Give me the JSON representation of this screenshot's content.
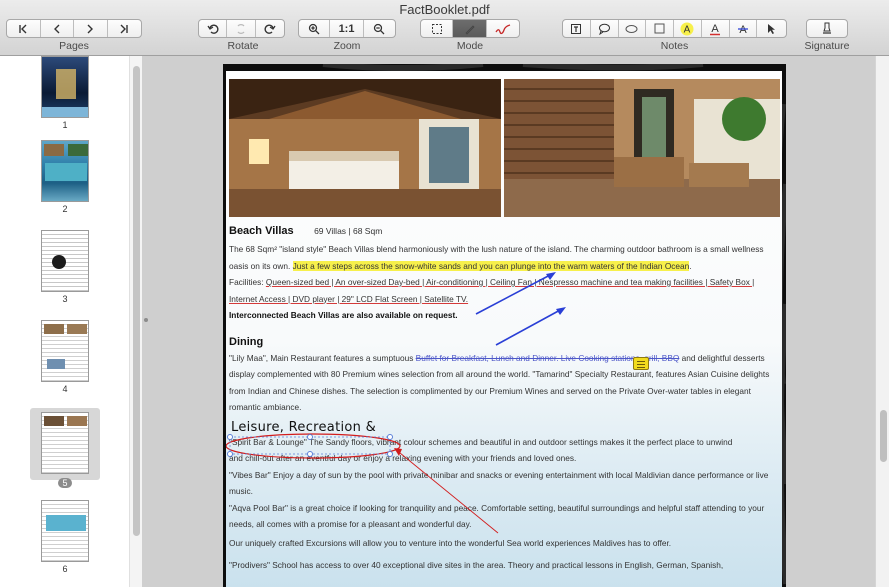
{
  "window": {
    "title": "FactBooklet.pdf"
  },
  "toolbar": {
    "pages_label": "Pages",
    "rotate_label": "Rotate",
    "zoom_label": "Zoom",
    "zoom_actual": "1:1",
    "mode_label": "Mode",
    "notes_label": "Notes",
    "signature_label": "Signature"
  },
  "sidebar": {
    "pages": [
      {
        "num": "1"
      },
      {
        "num": "2"
      },
      {
        "num": "3"
      },
      {
        "num": "4"
      },
      {
        "num": "5",
        "selected": true
      },
      {
        "num": "6"
      }
    ]
  },
  "document": {
    "beach_heading": "Beach Villas",
    "beach_meta": "69 Villas | 68 Sqm",
    "beach_p1a": "The 68 Sqm² \"island style\" Beach Villas blend harmoniously with the lush nature of the island. The charming outdoor bathroom is a    small wellness",
    "beach_p1b": "oasis on its own. ",
    "beach_highlight": "Just a few steps across the snow-white sands and you can plunge into the warm waters of the Indian Ocean",
    "beach_p1c": ".",
    "facilities_label": "Facilities: ",
    "facilities_1": "Queen-sized bed | An over-sized Day-bed | Air-conditioning | Ceiling Fan | Nespresso machine and tea making facilities | Safety Box |",
    "facilities_2": "Internet Access | DVD player | 29\" LCD Flat Screen | Satellite TV.",
    "interconnected": "Interconnected Beach Villas are also available on request.",
    "dining_heading": "Dining",
    "dining_1a": "\"Lily Maa\", Main Restaurant features a sumptuous ",
    "dining_strike": "Buffet for Breakfast, Lunch and Dinner. Live Cooking stations, grill, BBQ",
    "dining_1b": " and    delightful desserts",
    "dining_2": "display complemented with 80 Premium wines selection from all around the world. \"Tamarind\" Specialty Restaurant, features Asian Cuisine delights",
    "dining_3": "from Indian and Chinese dishes. The selection is complimented by our Premium Wines and served on the Private Over-water tables in elegant",
    "dining_4": "romantic ambiance.",
    "textbox": "Leisure, Recreation &",
    "leisure_1": "\"Spirit Bar & Lounge\" The Sandy floors, vibrant colour schemes and beautiful in and outdoor settings makes it the perfect place           to unwind",
    "leisure_2": "and chill-out after an eventful day or enjoy a relaxing evening with your friends and loved ones.",
    "leisure_3": "\"Vibes Bar\" Enjoy a day of sun by the pool with private minibar and snacks or evening entertainment with local Maldivian dance performance or live",
    "leisure_4": "music.",
    "leisure_5": "\"Aqva Pool Bar\" is a great choice if looking for tranquility and peace. Comfortable setting, beautiful surroundings and helpful staff attending to your",
    "leisure_6": "needs, all comes with a promise for a pleasant and wonderful day.",
    "leisure_7": "Our uniquely crafted Excursions will allow you to venture into the wonderful Sea world experiences Maldives has to offer.",
    "leisure_8": "\"Prodivers\" School has access to over 40 exceptional dive sites in the area. Theory and practical lessons in English, German, Spanish,"
  },
  "colors": {
    "highlight": "#f7f04b",
    "arrow_blue": "#2a3fd6",
    "ellipse_red": "#d21c1c",
    "strike_blue": "#4d57c8",
    "note_yellow": "#f2dc1e"
  },
  "icons": [
    "first-page-icon",
    "prev-page-icon",
    "next-page-icon",
    "last-page-icon",
    "rotate-left-icon",
    "rotate-flip-icon",
    "rotate-right-icon",
    "zoom-in-icon",
    "zoom-out-icon",
    "select-icon",
    "pen-icon",
    "signature-mode-icon",
    "text-box-icon",
    "speech-bubble-icon",
    "ellipse-icon",
    "rectangle-icon",
    "highlight-icon",
    "underline-icon",
    "strikethrough-icon",
    "arrow-cursor-icon",
    "signature-icon",
    "sticky-note-icon"
  ]
}
